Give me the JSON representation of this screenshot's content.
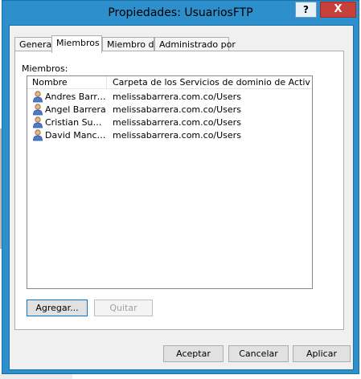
{
  "window": {
    "title": "Propiedades: UsuariosFTP",
    "help_label": "?",
    "close_label": "X"
  },
  "tabs": [
    {
      "label": "General",
      "active": false
    },
    {
      "label": "Miembros",
      "active": true
    },
    {
      "label": "Miembro de",
      "active": false
    },
    {
      "label": "Administrado por",
      "active": false
    }
  ],
  "members": {
    "label": "Miembros:",
    "columns": [
      "Nombre",
      "Carpeta de los Servicios de dominio de Active Dir..."
    ],
    "rows": [
      {
        "name": "Andres Barrera",
        "folder": "melissabarrera.com.co/Users"
      },
      {
        "name": "Angel Barrera",
        "folder": "melissabarrera.com.co/Users"
      },
      {
        "name": "Cristian Suan...",
        "folder": "melissabarrera.com.co/Users"
      },
      {
        "name": "David Mancipe",
        "folder": "melissabarrera.com.co/Users"
      }
    ],
    "row_icon": "user-icon",
    "add_label": "Agregar...",
    "remove_label": "Quitar"
  },
  "footer": {
    "ok_label": "Aceptar",
    "cancel_label": "Cancelar",
    "apply_label": "Aplicar"
  },
  "colors": {
    "frame": "#2e8fcd",
    "close": "#c7403a"
  }
}
